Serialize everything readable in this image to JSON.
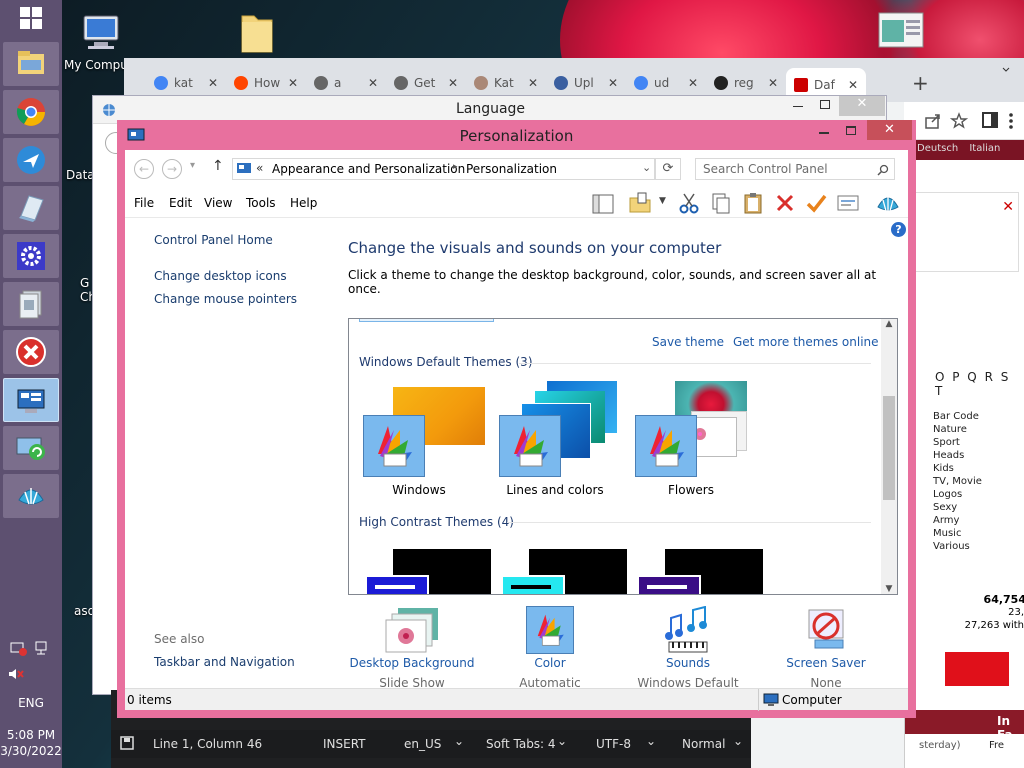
{
  "desktop": {
    "icons": [
      {
        "label": "My Compu"
      },
      {
        "label": "Data"
      },
      {
        "label": "G"
      },
      {
        "label": "Ch"
      },
      {
        "label": "asd"
      }
    ]
  },
  "taskbar": {
    "items": [
      "start-icon",
      "file-explorer-icon",
      "chrome-icon",
      "app-icon",
      "notepad-icon",
      "settings-icon",
      "files-icon",
      "close-app-icon",
      "control-panel-icon",
      "sync-icon",
      "shell-icon"
    ],
    "tray": {
      "lang": "ENG",
      "time": "5:08 PM",
      "date": "3/30/2022"
    }
  },
  "chrome": {
    "tabs": [
      {
        "label": "kat",
        "icon": "google-icon"
      },
      {
        "label": "How",
        "icon": "reddit-icon"
      },
      {
        "label": "a",
        "icon": "globe-icon"
      },
      {
        "label": "Get",
        "icon": "globe-icon"
      },
      {
        "label": "Kat",
        "icon": "person-icon"
      },
      {
        "label": "Upl",
        "icon": "app-icon"
      },
      {
        "label": "ud",
        "icon": "google-icon"
      },
      {
        "label": "reg",
        "icon": "github-icon"
      },
      {
        "label": "Daf",
        "icon": "dafont-icon"
      }
    ],
    "page": {
      "langs": [
        "Deutsch",
        "Italian"
      ],
      "letters": "O P Q R S T",
      "cats": [
        "Bar Code",
        "Nature",
        "Sport",
        "Heads",
        "Kids",
        "TV, Movie",
        "Logos",
        "Sexy",
        "Army",
        "Music",
        "Various"
      ],
      "count1": "64,754",
      "count2": "23,",
      "count3": "27,263 with",
      "infa": "In Fa",
      "yesterday": "sterday)",
      "fre": "Fre"
    }
  },
  "language_window": {
    "title": "Language"
  },
  "editor_status": {
    "position": "Line 1, Column 46",
    "mode": "INSERT",
    "locale": "en_US",
    "tabs": "Soft Tabs: 4",
    "encoding": "UTF-8",
    "view": "Normal"
  },
  "personalization": {
    "title": "Personalization",
    "breadcrumb": [
      "Appearance and Personalization",
      "Personalization"
    ],
    "breadcrumb_prefix": "«",
    "search_placeholder": "Search Control Panel",
    "menu": [
      "File",
      "Edit",
      "View",
      "Tools",
      "Help"
    ],
    "left": {
      "home": "Control Panel Home",
      "links": [
        "Change desktop icons",
        "Change mouse pointers"
      ],
      "see_also": "See also",
      "see_also_links": [
        "Taskbar and Navigation"
      ]
    },
    "heading": "Change the visuals and sounds on your computer",
    "subheading": "Click a theme to change the desktop background, color, sounds, and screen saver all at once.",
    "save_theme": "Save theme",
    "more_themes": "Get more themes online",
    "group_default": "Windows Default Themes (3)",
    "themes": [
      "Windows",
      "Lines and colors",
      "Flowers"
    ],
    "group_contrast": "High Contrast Themes (4)",
    "bottom": [
      {
        "title": "Desktop Background",
        "sub": "Slide Show"
      },
      {
        "title": "Color",
        "sub": "Automatic"
      },
      {
        "title": "Sounds",
        "sub": "Windows Default"
      },
      {
        "title": "Screen Saver",
        "sub": "None"
      }
    ],
    "status": {
      "items": "0 items",
      "location": "Computer"
    }
  }
}
